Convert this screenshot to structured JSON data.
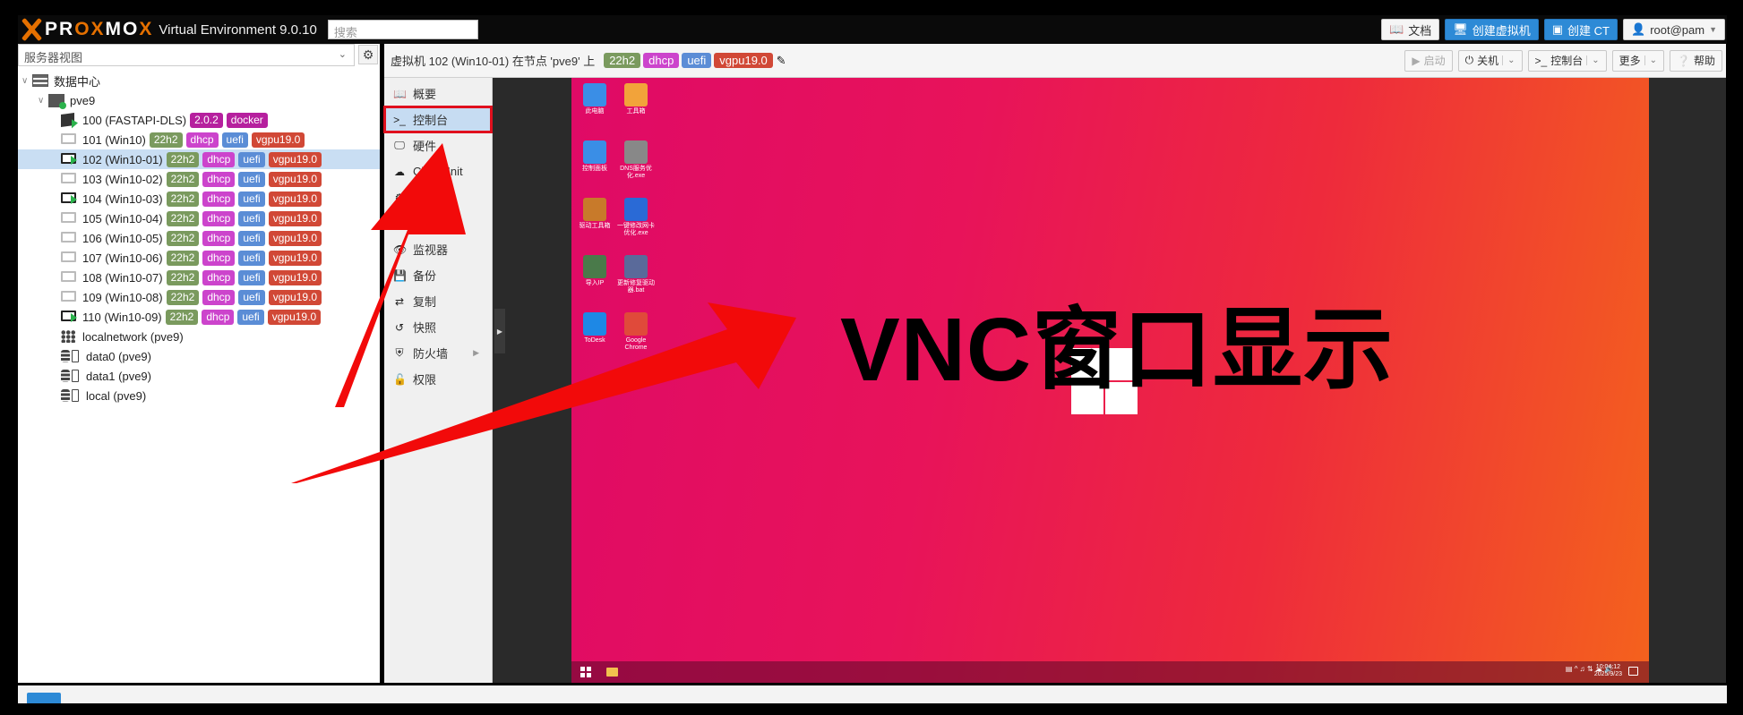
{
  "topbar": {
    "logo_text_a": "PR",
    "logo_text_ox": "OX",
    "logo_text_b": "MO",
    "logo_text_x": "X",
    "product": "Virtual Environment 9.0.10",
    "search_placeholder": "搜索",
    "buttons": {
      "docs": "文档",
      "create_vm": "创建虚拟机",
      "create_ct": "创建 CT",
      "user": "root@pam"
    }
  },
  "left": {
    "view_selector": "服务器视图",
    "datacenter": "数据中心",
    "node": "pve9",
    "guests": [
      {
        "label": "100 (FASTAPI-DLS)",
        "kind": "ct",
        "state": "running",
        "tags": [
          {
            "text": "2.0.2",
            "color": "#b6209e"
          },
          {
            "text": "docker",
            "color": "#b6209e"
          }
        ]
      },
      {
        "label": "101 (Win10)",
        "kind": "vm",
        "state": "stopped",
        "tags": [
          {
            "text": "22h2",
            "color": "#7a9a5e"
          },
          {
            "text": "dhcp",
            "color": "#cc44cc"
          },
          {
            "text": "uefi",
            "color": "#5b8dd6"
          },
          {
            "text": "vgpu19.0",
            "color": "#d14836"
          }
        ]
      },
      {
        "label": "102 (Win10-01)",
        "kind": "vm",
        "state": "running",
        "selected": true,
        "tags": [
          {
            "text": "22h2",
            "color": "#7a9a5e"
          },
          {
            "text": "dhcp",
            "color": "#cc44cc"
          },
          {
            "text": "uefi",
            "color": "#5b8dd6"
          },
          {
            "text": "vgpu19.0",
            "color": "#d14836"
          }
        ]
      },
      {
        "label": "103 (Win10-02)",
        "kind": "vm",
        "state": "stopped",
        "tags": [
          {
            "text": "22h2",
            "color": "#7a9a5e"
          },
          {
            "text": "dhcp",
            "color": "#cc44cc"
          },
          {
            "text": "uefi",
            "color": "#5b8dd6"
          },
          {
            "text": "vgpu19.0",
            "color": "#d14836"
          }
        ]
      },
      {
        "label": "104 (Win10-03)",
        "kind": "vm",
        "state": "running",
        "tags": [
          {
            "text": "22h2",
            "color": "#7a9a5e"
          },
          {
            "text": "dhcp",
            "color": "#cc44cc"
          },
          {
            "text": "uefi",
            "color": "#5b8dd6"
          },
          {
            "text": "vgpu19.0",
            "color": "#d14836"
          }
        ]
      },
      {
        "label": "105 (Win10-04)",
        "kind": "vm",
        "state": "stopped",
        "tags": [
          {
            "text": "22h2",
            "color": "#7a9a5e"
          },
          {
            "text": "dhcp",
            "color": "#cc44cc"
          },
          {
            "text": "uefi",
            "color": "#5b8dd6"
          },
          {
            "text": "vgpu19.0",
            "color": "#d14836"
          }
        ]
      },
      {
        "label": "106 (Win10-05)",
        "kind": "vm",
        "state": "stopped",
        "tags": [
          {
            "text": "22h2",
            "color": "#7a9a5e"
          },
          {
            "text": "dhcp",
            "color": "#cc44cc"
          },
          {
            "text": "uefi",
            "color": "#5b8dd6"
          },
          {
            "text": "vgpu19.0",
            "color": "#d14836"
          }
        ]
      },
      {
        "label": "107 (Win10-06)",
        "kind": "vm",
        "state": "stopped",
        "tags": [
          {
            "text": "22h2",
            "color": "#7a9a5e"
          },
          {
            "text": "dhcp",
            "color": "#cc44cc"
          },
          {
            "text": "uefi",
            "color": "#5b8dd6"
          },
          {
            "text": "vgpu19.0",
            "color": "#d14836"
          }
        ]
      },
      {
        "label": "108 (Win10-07)",
        "kind": "vm",
        "state": "stopped",
        "tags": [
          {
            "text": "22h2",
            "color": "#7a9a5e"
          },
          {
            "text": "dhcp",
            "color": "#cc44cc"
          },
          {
            "text": "uefi",
            "color": "#5b8dd6"
          },
          {
            "text": "vgpu19.0",
            "color": "#d14836"
          }
        ]
      },
      {
        "label": "109 (Win10-08)",
        "kind": "vm",
        "state": "stopped",
        "tags": [
          {
            "text": "22h2",
            "color": "#7a9a5e"
          },
          {
            "text": "dhcp",
            "color": "#cc44cc"
          },
          {
            "text": "uefi",
            "color": "#5b8dd6"
          },
          {
            "text": "vgpu19.0",
            "color": "#d14836"
          }
        ]
      },
      {
        "label": "110 (Win10-09)",
        "kind": "vm",
        "state": "running",
        "tags": [
          {
            "text": "22h2",
            "color": "#7a9a5e"
          },
          {
            "text": "dhcp",
            "color": "#cc44cc"
          },
          {
            "text": "uefi",
            "color": "#5b8dd6"
          },
          {
            "text": "vgpu19.0",
            "color": "#d14836"
          }
        ]
      }
    ],
    "network": "localnetwork (pve9)",
    "storages": [
      "data0 (pve9)",
      "data1 (pve9)",
      "local (pve9)"
    ]
  },
  "main": {
    "title": "虚拟机 102 (Win10-01) 在节点 'pve9' 上",
    "tags": [
      {
        "text": "22h2",
        "color": "#7a9a5e"
      },
      {
        "text": "dhcp",
        "color": "#cc44cc"
      },
      {
        "text": "uefi",
        "color": "#5b8dd6"
      },
      {
        "text": "vgpu19.0",
        "color": "#d14836"
      }
    ],
    "buttons": {
      "start": "启动",
      "shutdown": "关机",
      "console": "控制台",
      "more": "更多",
      "help": "帮助"
    },
    "menu": [
      {
        "label": "概要",
        "icon": "book-icon"
      },
      {
        "label": "控制台",
        "icon": "terminal-icon",
        "active": true
      },
      {
        "label": "硬件",
        "icon": "monitor-icon"
      },
      {
        "label": "Cloud-Init",
        "icon": "cloud-icon"
      },
      {
        "label": "选项",
        "icon": "gear-icon"
      },
      {
        "label": "任务历史",
        "icon": "list-icon"
      },
      {
        "label": "监视器",
        "icon": "eye-icon"
      },
      {
        "label": "备份",
        "icon": "floppy-icon"
      },
      {
        "label": "复制",
        "icon": "retweet-icon"
      },
      {
        "label": "快照",
        "icon": "history-icon"
      },
      {
        "label": "防火墙",
        "icon": "shield-icon",
        "submenu": true
      },
      {
        "label": "权限",
        "icon": "unlock-icon"
      }
    ]
  },
  "vnc": {
    "overlay_label": "VNC窗口显示",
    "desktop_icons": [
      "此电脑",
      "工具箱",
      "控制面板",
      "DNS服务优化.exe",
      "驱动工具箱",
      "一键修改网卡优化.exe",
      "导入IP",
      "更新修复驱动器.bat",
      "ToDesk",
      "Google Chrome"
    ],
    "clock_time": "10:04:12",
    "clock_date": "2025/9/23"
  },
  "colors": {
    "accent": "#2d8ad6",
    "highlight_box": "#e0101e",
    "arrow": "#f20a0a"
  }
}
